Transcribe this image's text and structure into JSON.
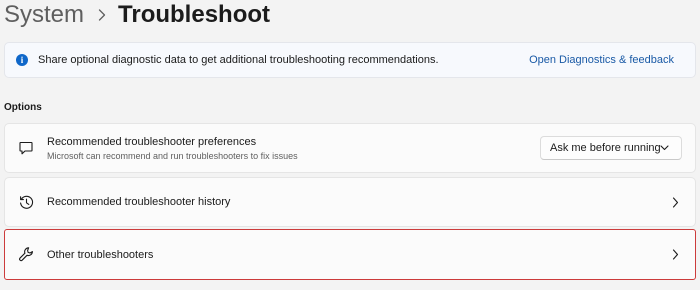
{
  "breadcrumb": {
    "parent": "System",
    "current": "Troubleshoot"
  },
  "info_bar": {
    "icon": "info-icon",
    "message": "Share optional diagnostic data to get additional troubleshooting recommendations.",
    "link": "Open Diagnostics & feedback"
  },
  "options": {
    "heading": "Options",
    "items": [
      {
        "icon": "chat-bubble-icon",
        "title": "Recommended troubleshooter preferences",
        "subtitle": "Microsoft can recommend and run troubleshooters to fix issues",
        "dropdown_value": "Ask me before running"
      },
      {
        "icon": "history-icon",
        "title": "Recommended troubleshooter history"
      },
      {
        "icon": "wrench-icon",
        "title": "Other troubleshooters",
        "highlighted": true
      }
    ]
  },
  "colors": {
    "accent": "#0f67c9",
    "link": "#1a5aa6",
    "highlight_border": "#cc3b3b",
    "background": "#f3f3f3"
  }
}
